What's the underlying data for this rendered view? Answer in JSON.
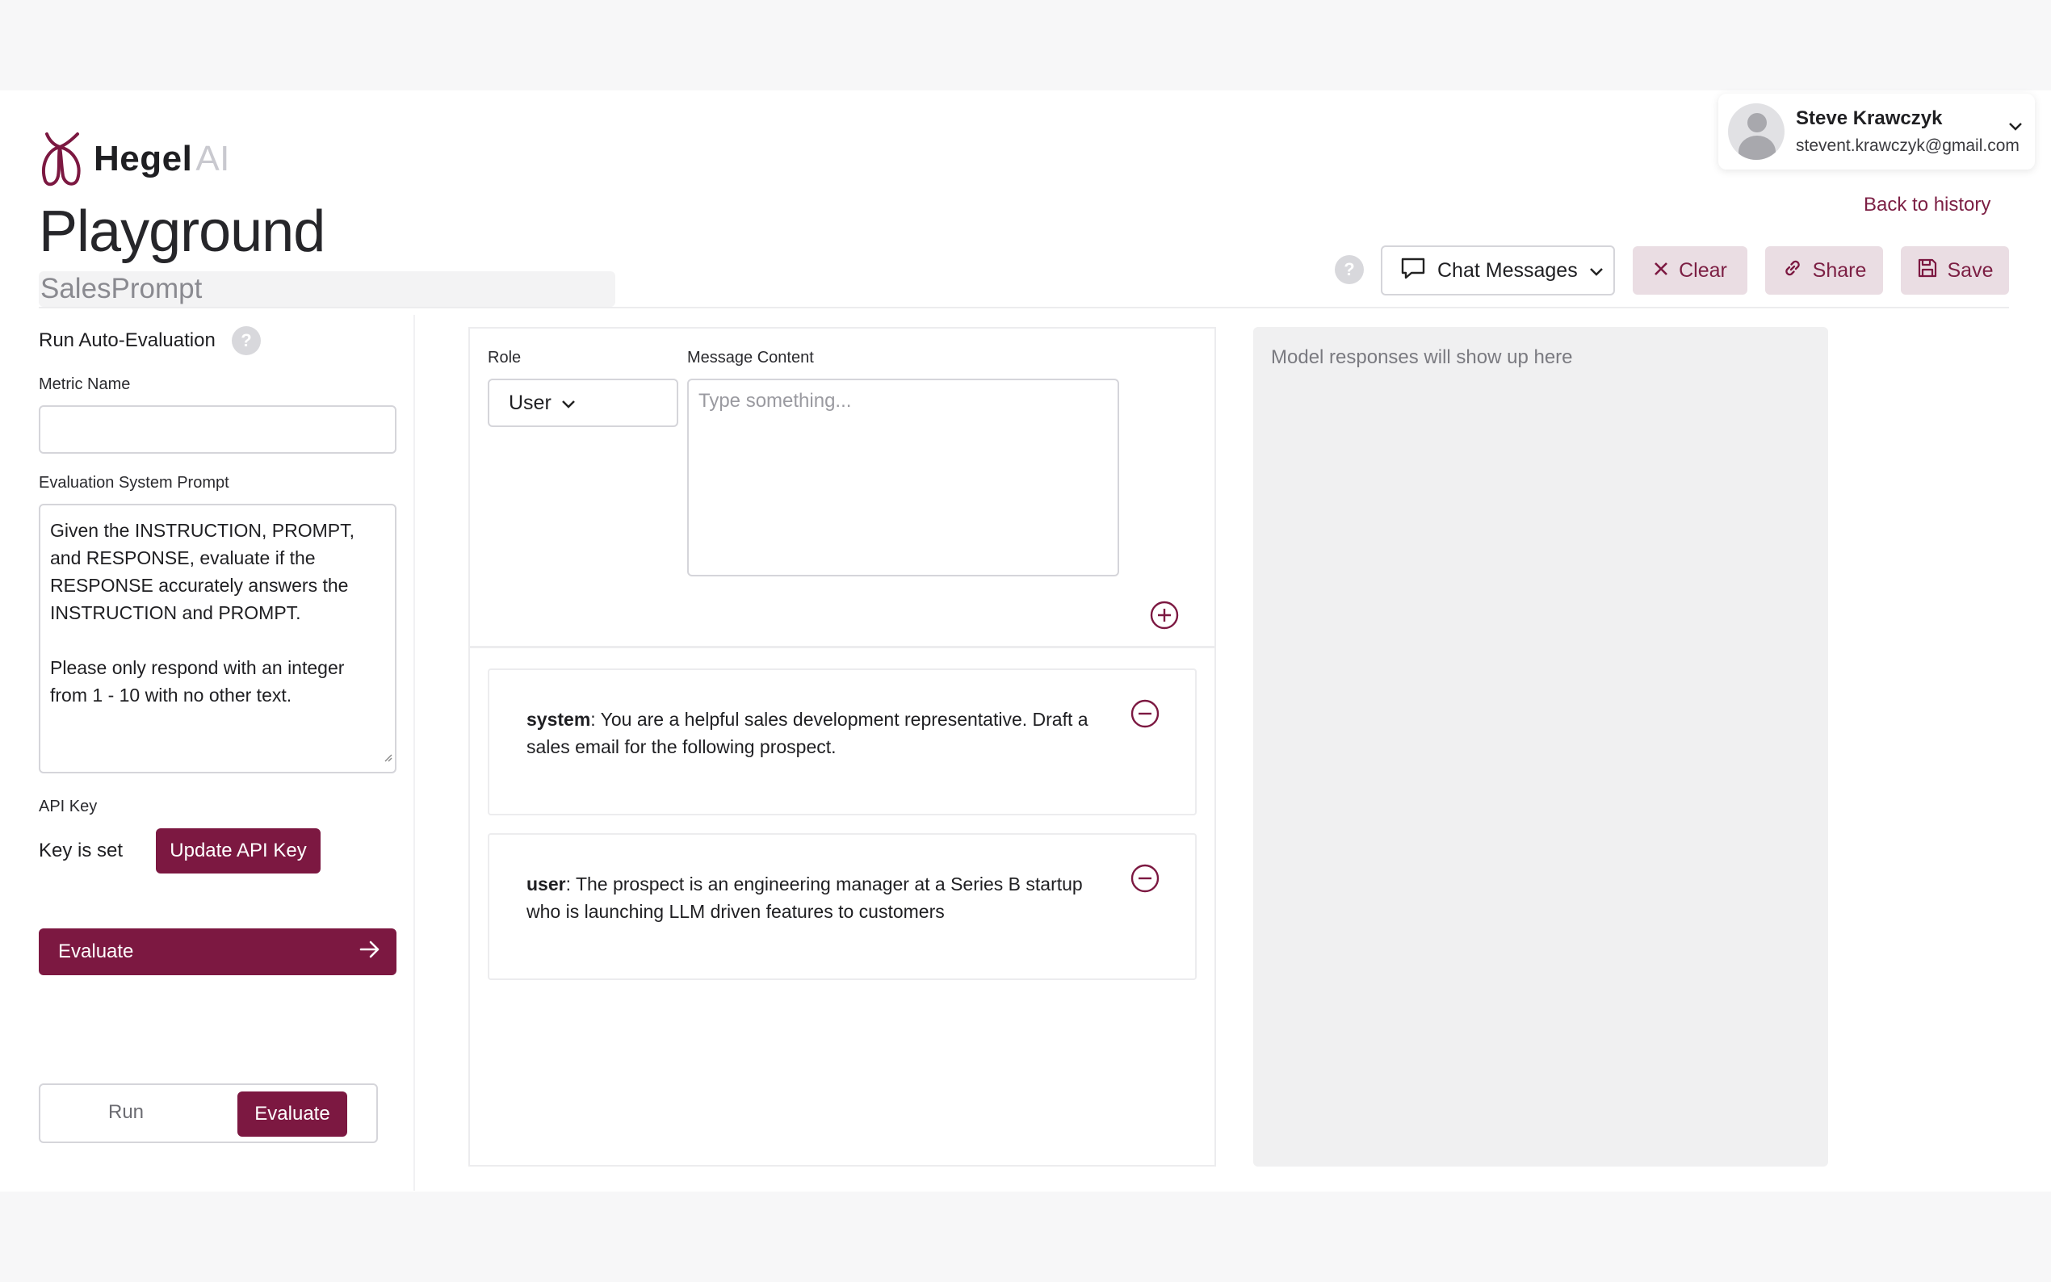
{
  "brand": {
    "name": "Hegel",
    "suffix": "AI"
  },
  "page": {
    "title": "Playground",
    "prompt_name": "SalesPrompt"
  },
  "user": {
    "name": "Steve Krawczyk",
    "email": "stevent.krawczyk@gmail.com"
  },
  "nav": {
    "back_link": "Back to history"
  },
  "toolbar": {
    "help": "?",
    "mode_select": "Chat Messages",
    "clear_label": "Clear",
    "share_label": "Share",
    "save_label": "Save"
  },
  "sidebar": {
    "auto_eval_label": "Run Auto-Evaluation",
    "help": "?",
    "metric_name_label": "Metric Name",
    "metric_name_value": "",
    "eval_prompt_label": "Evaluation System Prompt",
    "eval_prompt_value": "Given the INSTRUCTION, PROMPT, and RESPONSE, evaluate if the RESPONSE accurately answers the INSTRUCTION and PROMPT.\n\nPlease only respond with an integer from 1 - 10 with no other text.",
    "api_key_label": "API Key",
    "api_key_status": "Key is set",
    "update_key_label": "Update API Key",
    "evaluate_label": "Evaluate",
    "toggle": {
      "run_label": "Run",
      "evaluate_label": "Evaluate",
      "active": "Evaluate"
    }
  },
  "composer": {
    "role_label": "Role",
    "role_value": "User",
    "content_label": "Message Content",
    "content_placeholder": "Type something..."
  },
  "messages": [
    {
      "role": "system",
      "text": ": You are a helpful sales development representative. Draft a sales email for the following prospect."
    },
    {
      "role": "user",
      "text": ": The prospect is an engineering manager at a Series B startup who is launching LLM driven features to customers"
    }
  ],
  "response": {
    "placeholder": "Model responses will show up here"
  },
  "colors": {
    "brand": "#7c1841",
    "soft": "#eadde3",
    "panel": "#f0f0f1"
  }
}
